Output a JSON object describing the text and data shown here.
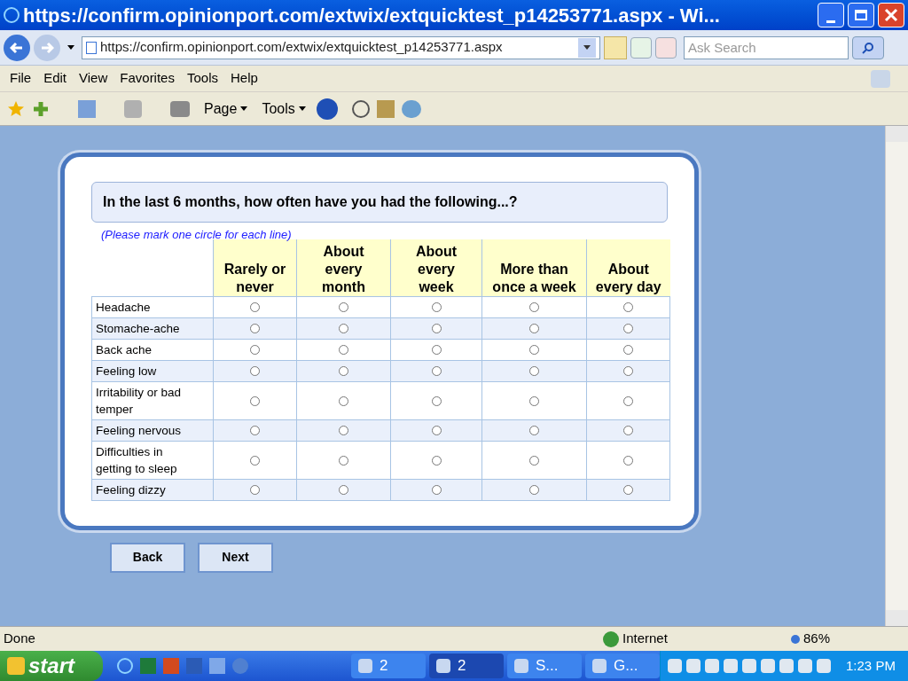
{
  "window": {
    "title": "https://confirm.opinionport.com/extwix/extquicktest_p14253771.aspx - Wi..."
  },
  "address_bar": {
    "url": "https://confirm.opinionport.com/extwix/extquicktest_p14253771.aspx",
    "search_placeholder": "Ask Search"
  },
  "menu": [
    "File",
    "Edit",
    "View",
    "Favorites",
    "Tools",
    "Help"
  ],
  "toolbar": {
    "page": "Page",
    "tools": "Tools"
  },
  "survey": {
    "question": "In the last 6 months, how often have you had the following...?",
    "instruction": "(Please mark one circle for each line)",
    "columns": [
      "Rarely or never",
      "About every month",
      "About every week",
      "More than once a week",
      "About every day"
    ],
    "rows": [
      {
        "label": "Headache",
        "options": [
          {
            "selected": false
          },
          {
            "selected": false
          },
          {
            "selected": false
          },
          {
            "selected": false
          },
          {
            "selected": false
          }
        ]
      },
      {
        "label": "Stomache-ache",
        "options": [
          {
            "selected": false
          },
          {
            "selected": false
          },
          {
            "selected": false
          },
          {
            "selected": false
          },
          {
            "selected": false
          }
        ]
      },
      {
        "label": "Back ache",
        "options": [
          {
            "selected": false
          },
          {
            "selected": false
          },
          {
            "selected": false
          },
          {
            "selected": false
          },
          {
            "selected": false
          }
        ]
      },
      {
        "label": "Feeling low",
        "options": [
          {
            "selected": false
          },
          {
            "selected": false
          },
          {
            "selected": false
          },
          {
            "selected": false
          },
          {
            "selected": false
          }
        ]
      },
      {
        "label": "Irritability or bad temper",
        "options": [
          {
            "selected": false
          },
          {
            "selected": false
          },
          {
            "selected": false
          },
          {
            "selected": false
          },
          {
            "selected": false
          }
        ]
      },
      {
        "label": "Feeling nervous",
        "options": [
          {
            "selected": false
          },
          {
            "selected": false
          },
          {
            "selected": false
          },
          {
            "selected": false
          },
          {
            "selected": false
          }
        ]
      },
      {
        "label": "Difficulties in getting to sleep",
        "options": [
          {
            "selected": false
          },
          {
            "selected": false
          },
          {
            "selected": false
          },
          {
            "selected": false
          },
          {
            "selected": false
          }
        ]
      },
      {
        "label": "Feeling dizzy",
        "options": [
          {
            "selected": false
          },
          {
            "selected": false
          },
          {
            "selected": false
          },
          {
            "selected": false
          },
          {
            "selected": false
          }
        ]
      }
    ],
    "buttons": [
      "Back",
      "Next"
    ]
  },
  "status_bar": {
    "status": "Done",
    "zone": "Internet",
    "zoom": "86%"
  },
  "taskbar": {
    "start": "start",
    "groups": [
      {
        "label": "2"
      },
      {
        "label": "2"
      },
      {
        "label": "S..."
      },
      {
        "label": "G..."
      }
    ],
    "clock": "1:23 PM"
  }
}
